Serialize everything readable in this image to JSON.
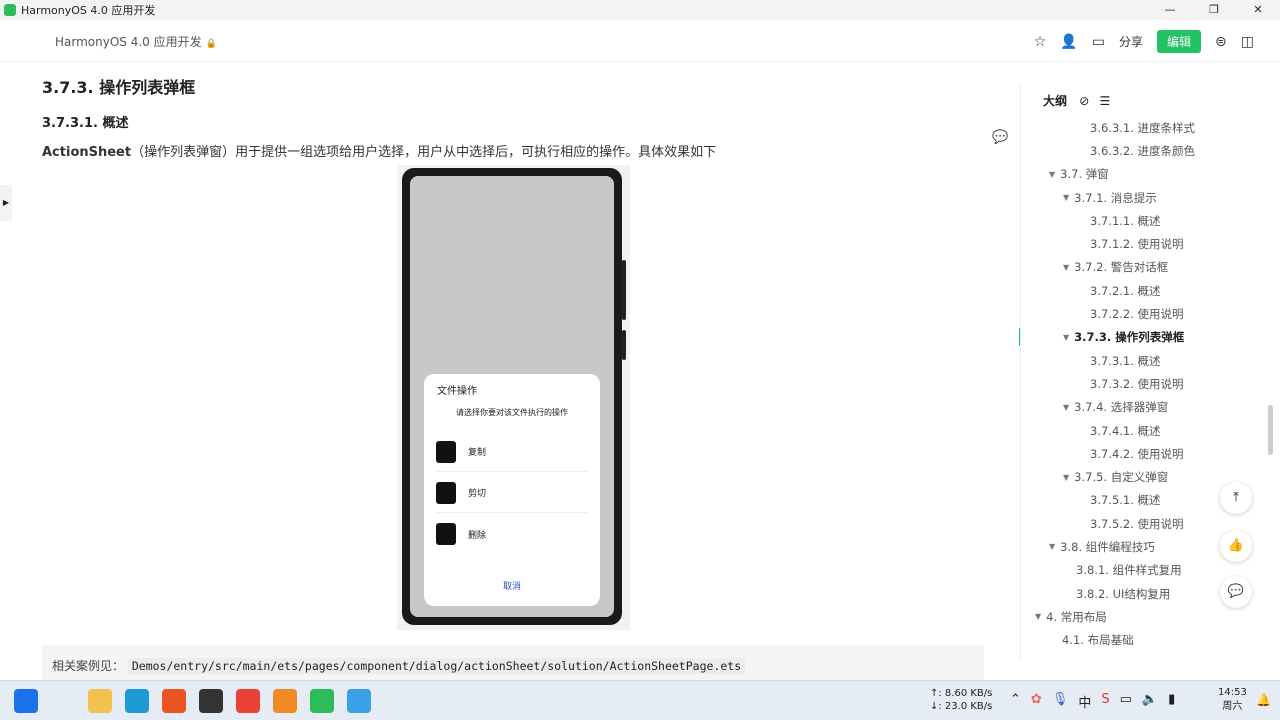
{
  "window": {
    "title": "HarmonyOS 4.0 应用开发",
    "minimize": "—",
    "maximize": "❐",
    "close": "✕"
  },
  "header": {
    "doc_title": "HarmonyOS 4.0 应用开发",
    "lock": "🔒",
    "share": "分享",
    "edit": "编辑"
  },
  "content": {
    "h2": "3.7.3. 操作列表弹框",
    "h3": "3.7.3.1. 概述",
    "para_strong": "ActionSheet",
    "para_rest": "（操作列表弹窗）用于提供一组选项给用户选择，用户从中选择后，可执行相应的操作。具体效果如下",
    "dialog": {
      "title": "文件操作",
      "subtitle": "请选择你要对该文件执行的操作",
      "items": [
        "复制",
        "剪切",
        "删除"
      ],
      "cancel": "取消"
    },
    "ref_label": "相关案例见：",
    "ref_path": "Demos/entry/src/main/ets/pages/component/dialog/actionSheet/solution/ActionSheetPage.ets"
  },
  "outline": {
    "title": "大纲",
    "items": [
      {
        "label": "3.6.3.1. 进度条样式",
        "level": 3,
        "tri": false
      },
      {
        "label": "3.6.3.2. 进度条颜色",
        "level": 3,
        "tri": false
      },
      {
        "label": "3.7. 弹窗",
        "level": 1,
        "tri": true
      },
      {
        "label": "3.7.1. 消息提示",
        "level": 2,
        "tri": true
      },
      {
        "label": "3.7.1.1. 概述",
        "level": 3,
        "tri": false
      },
      {
        "label": "3.7.1.2. 使用说明",
        "level": 3,
        "tri": false
      },
      {
        "label": "3.7.2. 警告对话框",
        "level": 2,
        "tri": true
      },
      {
        "label": "3.7.2.1. 概述",
        "level": 3,
        "tri": false
      },
      {
        "label": "3.7.2.2. 使用说明",
        "level": 3,
        "tri": false
      },
      {
        "label": "3.7.3. 操作列表弹框",
        "level": 2,
        "tri": true,
        "active": true
      },
      {
        "label": "3.7.3.1. 概述",
        "level": 3,
        "tri": false
      },
      {
        "label": "3.7.3.2. 使用说明",
        "level": 3,
        "tri": false
      },
      {
        "label": "3.7.4. 选择器弹窗",
        "level": 2,
        "tri": true
      },
      {
        "label": "3.7.4.1. 概述",
        "level": 3,
        "tri": false
      },
      {
        "label": "3.7.4.2. 使用说明",
        "level": 3,
        "tri": false
      },
      {
        "label": "3.7.5. 自定义弹窗",
        "level": 2,
        "tri": true
      },
      {
        "label": "3.7.5.1. 概述",
        "level": 3,
        "tri": false
      },
      {
        "label": "3.7.5.2. 使用说明",
        "level": 3,
        "tri": false
      },
      {
        "label": "3.8. 组件编程技巧",
        "level": 1,
        "tri": true
      },
      {
        "label": "3.8.1. 组件样式复用",
        "level": 2,
        "tri": false
      },
      {
        "label": "3.8.2. UI结构复用",
        "level": 2,
        "tri": false
      },
      {
        "label": "4. 常用布局",
        "level": 0,
        "tri": true
      },
      {
        "label": "4.1. 布局基础",
        "level": 1,
        "tri": false
      }
    ]
  },
  "taskbar": {
    "upload": "↑: 8.60 KB/s",
    "download": "↓: 23.0 KB/s",
    "time": "14:53",
    "day": "周六",
    "apps": [
      {
        "name": "start",
        "color": "#1a73e8"
      },
      {
        "name": "search",
        "color": "#e6ecf3"
      },
      {
        "name": "file-explorer",
        "color": "#f2c14e"
      },
      {
        "name": "edge",
        "color": "#1e9bd7"
      },
      {
        "name": "ubuntu",
        "color": "#e95420"
      },
      {
        "name": "terminal",
        "color": "#333333"
      },
      {
        "name": "chrome",
        "color": "#e94235"
      },
      {
        "name": "sublime",
        "color": "#f08a24"
      },
      {
        "name": "harmony-app",
        "color": "#2dbc5a"
      },
      {
        "name": "cloud",
        "color": "#3aa0e8"
      }
    ]
  },
  "colors": {
    "accent": "#23c265",
    "link": "#3050d0"
  }
}
